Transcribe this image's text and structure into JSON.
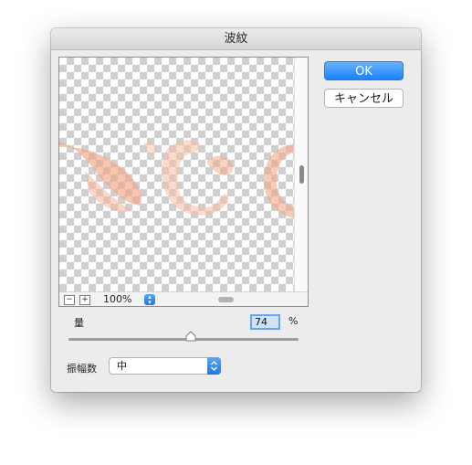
{
  "dialog": {
    "title": "波紋",
    "ok_label": "OK",
    "cancel_label": "キャンセル"
  },
  "preview": {
    "zoom_out_label": "−",
    "zoom_in_label": "+",
    "zoom_value": "100%"
  },
  "amount": {
    "label": "量",
    "value": "74",
    "unit": "%"
  },
  "size": {
    "label": "振幅数",
    "selected": "中"
  }
}
